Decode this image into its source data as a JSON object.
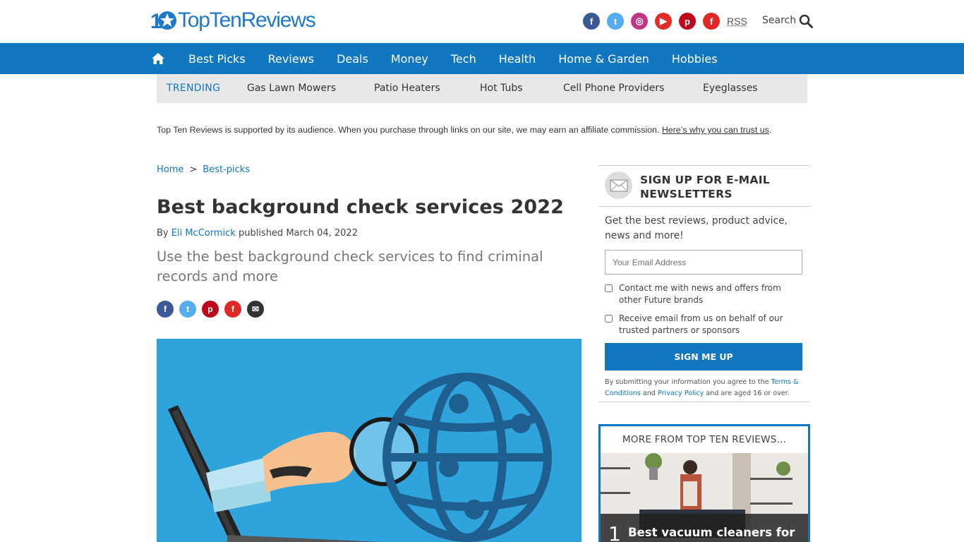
{
  "header": {
    "logo_prefix": "Top",
    "logo_mid": "Ten",
    "logo_suffix": "Reviews",
    "social": [
      {
        "icon": "facebook-icon",
        "glyph": "f",
        "color": "#3b5998"
      },
      {
        "icon": "twitter-icon",
        "glyph": "t",
        "color": "#55acee"
      },
      {
        "icon": "instagram-icon",
        "glyph": "◎",
        "color": "#c13584"
      },
      {
        "icon": "youtube-icon",
        "glyph": "▶",
        "color": "#e52d27"
      },
      {
        "icon": "pinterest-icon",
        "glyph": "p",
        "color": "#bd081c"
      },
      {
        "icon": "flipboard-icon",
        "glyph": "f",
        "color": "#e12828"
      }
    ],
    "rss_label": "RSS",
    "search_label": "Search"
  },
  "nav": {
    "items": [
      "Best Picks",
      "Reviews",
      "Deals",
      "Money",
      "Tech",
      "Health",
      "Home & Garden",
      "Hobbies"
    ],
    "color": "#1077c0"
  },
  "trending": {
    "label": "TRENDING",
    "items": [
      "Gas Lawn Mowers",
      "Patio Heaters",
      "Hot Tubs",
      "Cell Phone Providers",
      "Eyeglasses"
    ]
  },
  "affiliate": {
    "text": "Top Ten Reviews is supported by its audience. When you purchase through links on our site, we may earn an affiliate commission.",
    "link": "Here’s why you can trust us",
    "tail": "."
  },
  "article": {
    "breadcrumbs": [
      "Home",
      "Best-picks"
    ],
    "breadcrumb_sep": ">",
    "title": "Best background check services 2022",
    "by": "By",
    "author": "Eli McCormick",
    "published": "published March 04, 2022",
    "subtitle": "Use the best background check services to find criminal records and more",
    "share": [
      {
        "icon": "facebook-share-icon",
        "glyph": "f",
        "color": "#3b5998"
      },
      {
        "icon": "twitter-share-icon",
        "glyph": "t",
        "color": "#55acee"
      },
      {
        "icon": "pinterest-share-icon",
        "glyph": "p",
        "color": "#bd081c"
      },
      {
        "icon": "flipboard-share-icon",
        "glyph": "f",
        "color": "#e12828"
      },
      {
        "icon": "email-share-icon",
        "glyph": "✉",
        "color": "#333333"
      }
    ]
  },
  "newsletter": {
    "title": "SIGN UP FOR E-MAIL NEWSLETTERS",
    "desc": "Get the best reviews, product advice, news and more!",
    "email_placeholder": "Your Email Address",
    "check1": "Contact me with news and offers from other Future brands",
    "check2": "Receive email from us on behalf of our trusted partners or sponsors",
    "button": "SIGN ME UP",
    "legal_pre": "By submitting your information you agree to the",
    "terms": "Terms & Conditions",
    "and": "and",
    "privacy": "Privacy Policy",
    "legal_post": "and are aged 16 or over."
  },
  "more": {
    "heading": "MORE FROM TOP TEN REVIEWS...",
    "num": "1",
    "title": "Best vacuum cleaners for"
  }
}
